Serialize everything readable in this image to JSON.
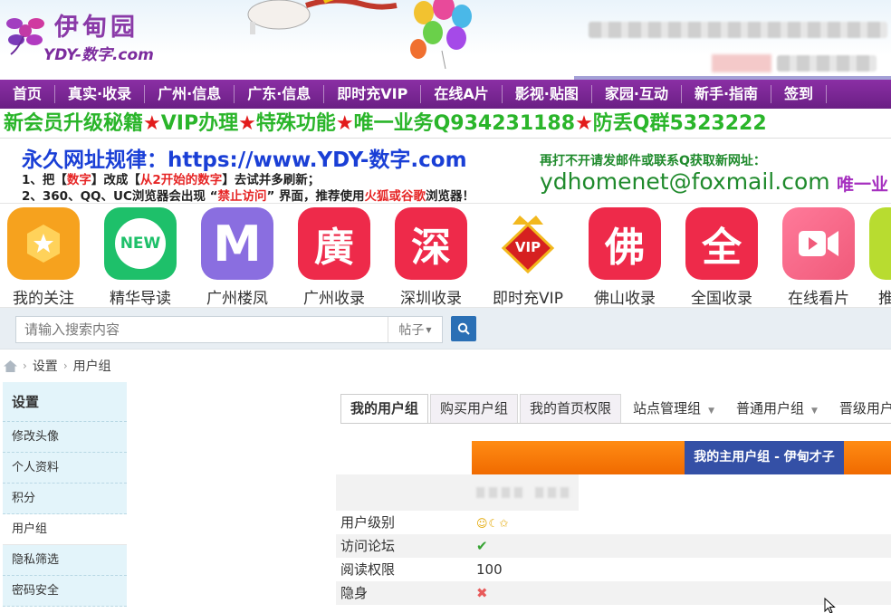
{
  "site": {
    "logo_cn": "伊甸园",
    "logo_en": "YDY-数字.com"
  },
  "nav": [
    "首页",
    "真实·收录",
    "广州·信息",
    "广东·信息",
    "即时充VIP",
    "在线A片",
    "影视·贴图",
    "家园·互动",
    "新手·指南",
    "签到"
  ],
  "announce": {
    "parts": [
      "新会员升级秘籍",
      "VIP办理",
      "特殊功能",
      "唯一业务Q934231188",
      "防丢Q群5323222"
    ],
    "star": "★"
  },
  "notice": {
    "title_label": "永久网址规律：",
    "title_url": "https://www.YDY-数字.com",
    "line1_a": "1、把【",
    "line1_b": "数字",
    "line1_c": "】改成【",
    "line1_d": "从2开始的数字",
    "line1_e": "】去试并多刷新；",
    "line2_a": "2、360、QQ、UC浏览器会出现 “",
    "line2_b": "禁止访问",
    "line2_c": "” 界面，推荐使用",
    "line2_d": "火狐或谷歌",
    "line2_e": "浏览器！",
    "right1": "再打不开请发邮件或联系Q获取新网址：",
    "email": "ydhomenet@foxmail.com",
    "right3": "唯一业"
  },
  "icons": [
    {
      "label": "我的关注",
      "glyph": "★",
      "color": "#f6a21e",
      "icon": "star-icon"
    },
    {
      "label": "精华导读",
      "glyph": "NEW",
      "color": "#1ec06a",
      "icon": "new-icon"
    },
    {
      "label": "广州楼凤",
      "glyph": "M",
      "color": "#8a6ee0",
      "icon": "m-icon"
    },
    {
      "label": "广州收录",
      "glyph": "廣",
      "color": "#ee2a4a",
      "icon": "guang-icon"
    },
    {
      "label": "深圳收录",
      "glyph": "深",
      "color": "#ee2a4a",
      "icon": "shen-icon"
    },
    {
      "label": "即时充VIP",
      "glyph": "VIP",
      "color": "#d62020",
      "icon": "vip-crown-icon"
    },
    {
      "label": "佛山收录",
      "glyph": "佛",
      "color": "#ee2a4a",
      "icon": "fo-icon"
    },
    {
      "label": "全国收录",
      "glyph": "全",
      "color": "#ee2a4a",
      "icon": "quan-icon"
    },
    {
      "label": "在线看片",
      "glyph": "▶",
      "color": "#f26b8a",
      "icon": "video-icon"
    },
    {
      "label": "推",
      "glyph": "",
      "color": "#b8dc30",
      "icon": "tui-icon"
    }
  ],
  "search": {
    "placeholder": "请输入搜索内容",
    "type": "帖子"
  },
  "breadcrumb": [
    "设置",
    "用户组"
  ],
  "sidebar": {
    "title": "设置",
    "items": [
      "修改头像",
      "个人资料",
      "积分",
      "用户组",
      "隐私筛选",
      "密码安全"
    ]
  },
  "tabs": [
    "我的用户组",
    "购买用户组",
    "我的首页权限",
    "站点管理组",
    "普通用户组",
    "晋级用户组"
  ],
  "group": {
    "title": "我的主用户组 - 伊甸才子"
  },
  "perms": [
    {
      "label": "用户级别",
      "value": ""
    },
    {
      "label": "访问论坛",
      "value": ""
    },
    {
      "label": "阅读权限",
      "value": "100"
    },
    {
      "label": "隐身",
      "value": ""
    }
  ],
  "colors": {
    "nav_purple": "#7a2696",
    "announce_green": "#2ab52a",
    "group_blue": "#3450a6",
    "group_orange": "#f47a06"
  }
}
